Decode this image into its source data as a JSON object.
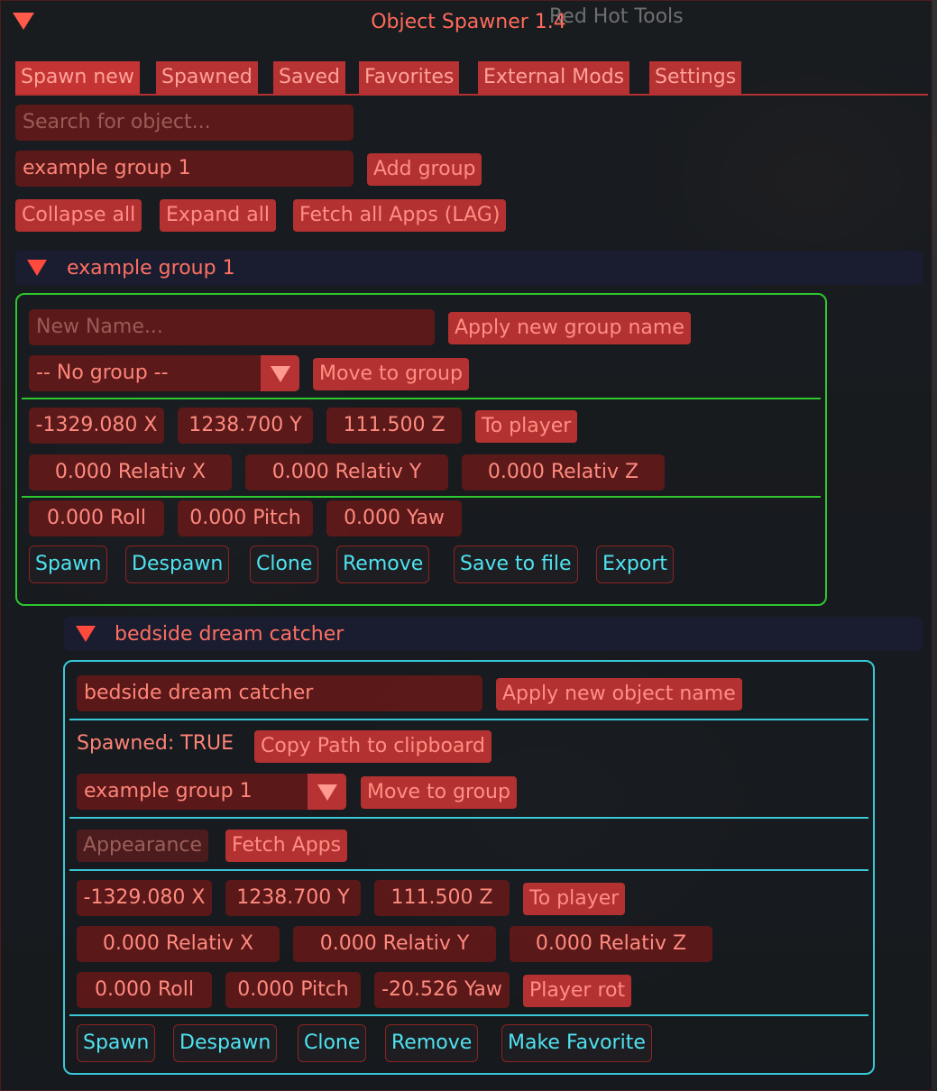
{
  "window": {
    "title": "Object Spawner 1.4",
    "background_text": "Red Hot Tools",
    "accent": "#b43131",
    "collapse_icon": "triangle-down-icon"
  },
  "tabs": [
    "Spawn new",
    "Spawned",
    "Saved",
    "Favorites",
    "External Mods",
    "Settings"
  ],
  "top": {
    "search_placeholder": "Search for object...",
    "group_name_value": "example group 1",
    "add_group": "Add group",
    "collapse_all": "Collapse all",
    "expand_all": "Expand all",
    "fetch_all": "Fetch all Apps (LAG)"
  },
  "group": {
    "header": "example group 1",
    "name_placeholder": "New Name...",
    "apply_name": "Apply new group name",
    "group_select": "-- No group --",
    "move_to_group": "Move to group",
    "pos": {
      "x": "-1329.080 X",
      "y": "1238.700 Y",
      "z": "111.500 Z"
    },
    "to_player": "To player",
    "rel": {
      "x": "0.000 Relativ X",
      "y": "0.000 Relativ Y",
      "z": "0.000 Relativ Z"
    },
    "rot": {
      "roll": "0.000 Roll",
      "pitch": "0.000 Pitch",
      "yaw": "0.000 Yaw"
    },
    "actions": {
      "spawn": "Spawn",
      "despawn": "Despawn",
      "clone": "Clone",
      "remove": "Remove",
      "save": "Save to file",
      "export": "Export"
    }
  },
  "object": {
    "header": "bedside dream catcher",
    "name_value": "bedside dream catcher",
    "apply_name": "Apply new object name",
    "spawned_status": "Spawned: TRUE",
    "copy_path": "Copy Path to clipboard",
    "group_select": "example group 1",
    "move_to_group": "Move to group",
    "appearance": "Appearance",
    "fetch_apps": "Fetch Apps",
    "pos": {
      "x": "-1329.080 X",
      "y": "1238.700 Y",
      "z": "111.500 Z"
    },
    "to_player": "To player",
    "rel": {
      "x": "0.000 Relativ X",
      "y": "0.000 Relativ Y",
      "z": "0.000 Relativ Z"
    },
    "rot": {
      "roll": "0.000 Roll",
      "pitch": "0.000 Pitch",
      "yaw": "-20.526 Yaw"
    },
    "player_rot": "Player rot",
    "actions": {
      "spawn": "Spawn",
      "despawn": "Despawn",
      "clone": "Clone",
      "remove": "Remove",
      "favorite": "Make Favorite"
    }
  }
}
